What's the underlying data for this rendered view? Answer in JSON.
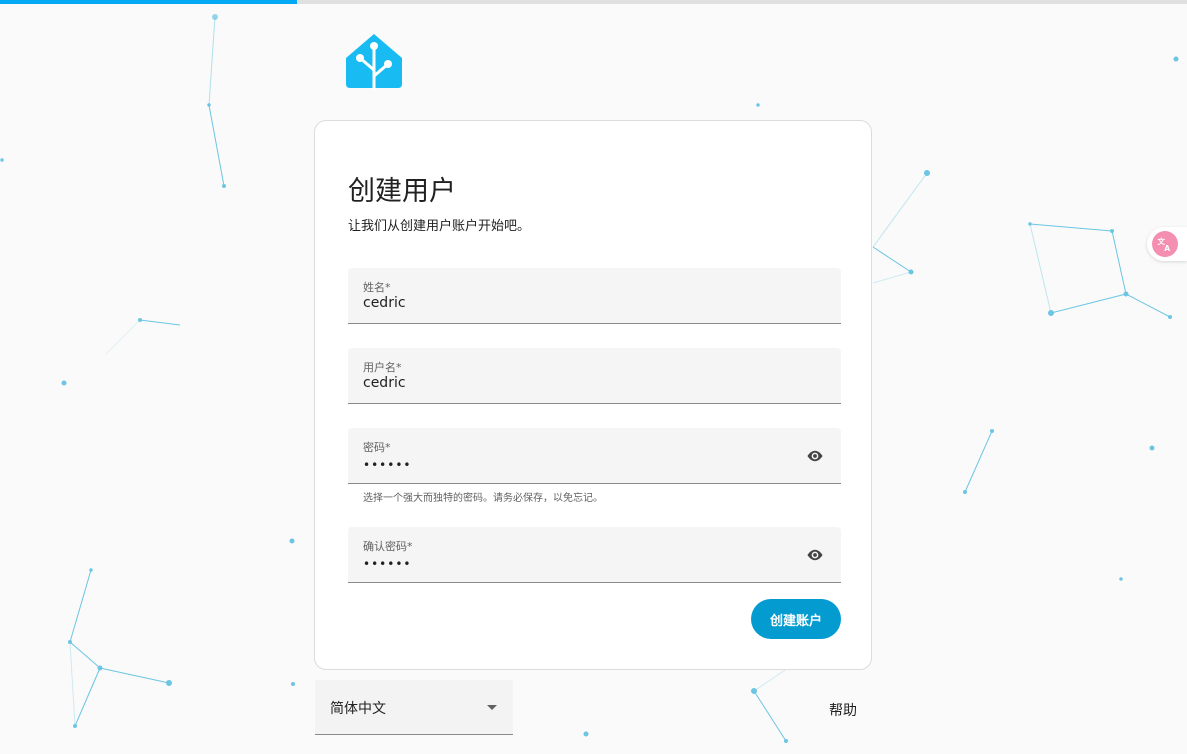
{
  "progress": {
    "percent": 25,
    "color": "#03a9f4"
  },
  "card": {
    "title": "创建用户",
    "subtitle": "让我们从创建用户账户开始吧。"
  },
  "fields": {
    "name": {
      "label": "姓名*",
      "value": "cedric"
    },
    "username": {
      "label": "用户名*",
      "value": "cedric"
    },
    "password": {
      "label": "密码*",
      "value": "••••••",
      "helper": "选择一个强大而独特的密码。请务必保存，以免忘记。"
    },
    "confirm_password": {
      "label": "确认密码*",
      "value": "••••••"
    }
  },
  "actions": {
    "create_account_label": "创建账户"
  },
  "footer": {
    "language_value": "简体中文",
    "help_label": "帮助"
  },
  "icons": {
    "logo": "home-assistant-logo-icon",
    "eye": "eye-icon",
    "dropdown": "caret-down-icon",
    "translate": "translate-icon"
  },
  "colors": {
    "accent": "#039bd0",
    "logo": "#18bcf2",
    "decor": "#5bbfe0"
  }
}
